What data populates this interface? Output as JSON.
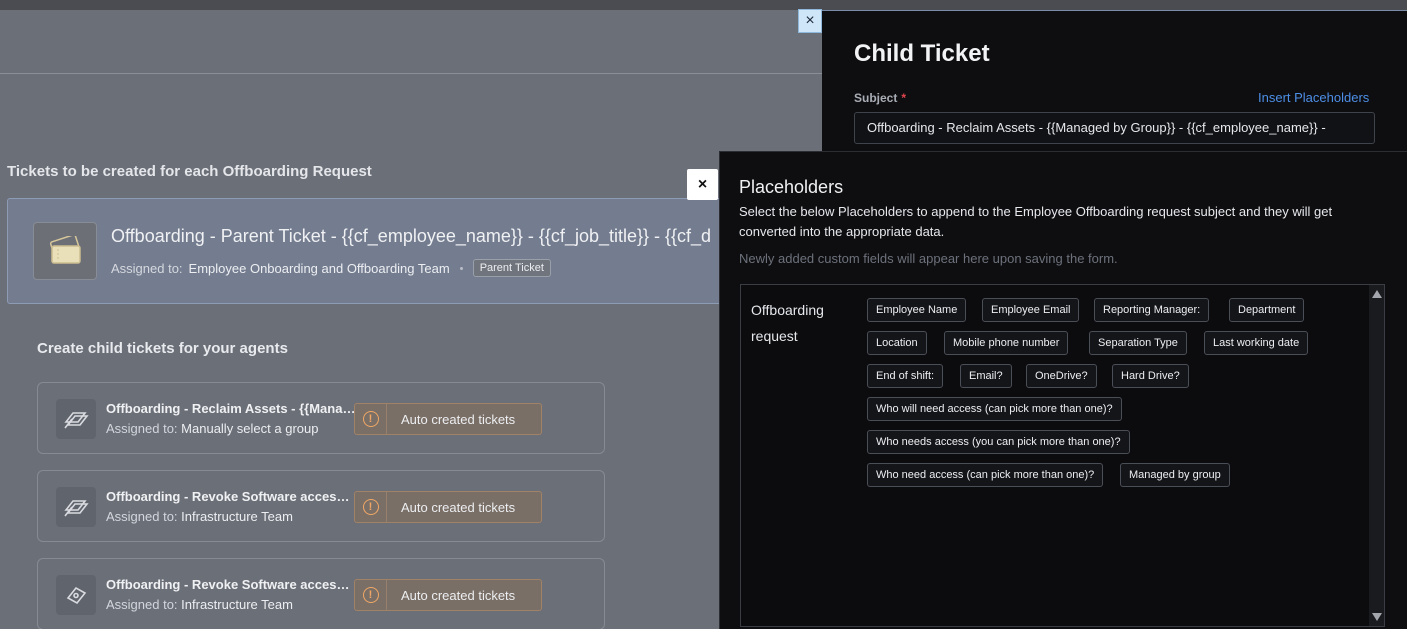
{
  "background": {
    "section_title": "Tickets to be created for each Offboarding Request",
    "parent_ticket": {
      "title": "Offboarding - Parent Ticket - {{cf_employee_name}} - {{cf_job_title}} - {{cf_d",
      "assigned_prefix": "Assigned to:",
      "assigned_to": "Employee Onboarding and Offboarding Team",
      "badge": "Parent Ticket",
      "icon": "ticket-icon"
    },
    "child_heading": "Create child tickets for your agents",
    "child_tickets": [
      {
        "title": "Offboarding - Reclaim Assets - {{Managed by Group}} - {{cf_employee_name}}",
        "assigned_prefix": "Assigned to:",
        "assigned_to": "Manually select a group",
        "button": "Auto created tickets",
        "icon": "ticket-stack-icon"
      },
      {
        "title": "Offboarding - Revoke Software access - {{cf_employee_name}}",
        "assigned_prefix": "Assigned to:",
        "assigned_to": "Infrastructure Team",
        "button": "Auto created tickets",
        "icon": "ticket-stack-icon"
      },
      {
        "title": "Offboarding - Revoke Software access - {{cf_employee_name}}",
        "assigned_prefix": "Assigned to:",
        "assigned_to": "Infrastructure Team",
        "button": "Auto created tickets",
        "icon": "ticket-icon"
      }
    ]
  },
  "child_ticket_panel": {
    "title": "Child Ticket",
    "subject_label": "Subject",
    "required_mark": "*",
    "insert_placeholders": "Insert Placeholders",
    "subject_value": "Offboarding - Reclaim Assets - {{Managed by Group}} - {{cf_employee_name}} -"
  },
  "placeholders": {
    "title": "Placeholders",
    "description": "Select the below Placeholders to append to the Employee Offboarding request subject and they will get converted into the appropriate data.",
    "note": "Newly added custom fields will appear here upon saving the form.",
    "category": "Offboarding request",
    "chips": [
      "Employee Name",
      "Employee Email",
      "Reporting Manager:",
      "Department",
      "Location",
      "Mobile phone number",
      "Separation Type",
      "Last working date",
      "End of shift:",
      "Email?",
      "OneDrive?",
      "Hard Drive?",
      "Who will need access (can pick more than one)?",
      "Who needs access (you can pick more than one)?",
      "Who need access (can pick more than one)?",
      "Managed by group"
    ]
  },
  "close_symbol": "×",
  "colors": {
    "accent_link": "#4d8ee6",
    "warning": "#f0a766",
    "panel_bg": "#0e0e10",
    "overlay_bg": "#6b6f78"
  }
}
